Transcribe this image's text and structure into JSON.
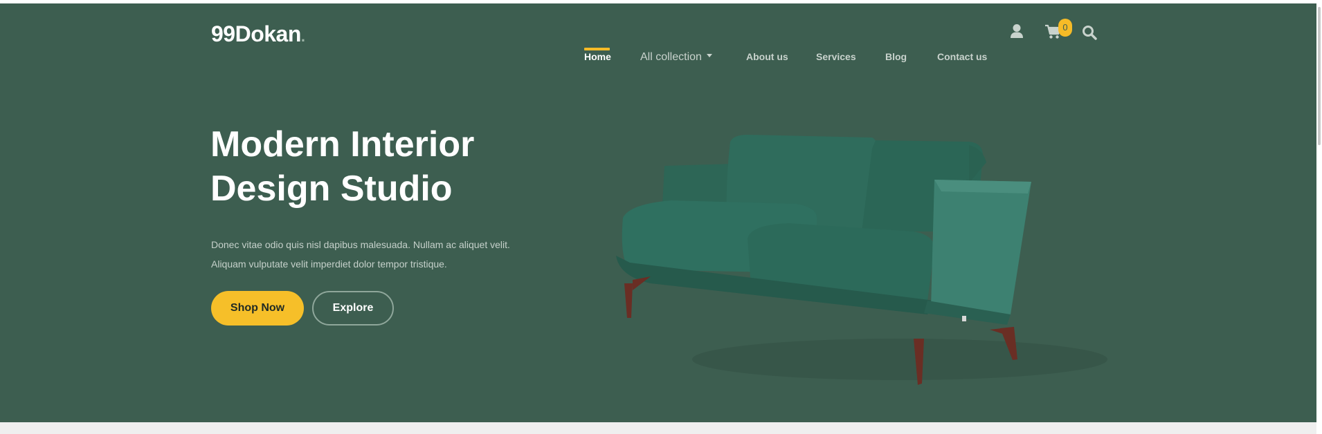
{
  "header": {
    "logo": "99Dokan",
    "logo_dot": ".",
    "nav": [
      {
        "label": "Home",
        "active": true
      },
      {
        "label": "All collection"
      },
      {
        "label": "About us"
      },
      {
        "label": "Services"
      },
      {
        "label": "Blog"
      },
      {
        "label": "Contact us"
      }
    ],
    "cart_count": "0",
    "icons": [
      "user-icon",
      "cart-icon",
      "search-icon"
    ]
  },
  "hero": {
    "headline_line1": "Modern Interior",
    "headline_line2": "Design Studio",
    "subtext_line1": "Donec vitae odio quis nisl dapibus malesuada. Nullam ac aliquet velit.",
    "subtext_line2": "Aliquam vulputate velit imperdiet dolor tempor tristique.",
    "primary_button": "Shop Now",
    "secondary_button": "Explore"
  },
  "colors": {
    "hero_bg": "#3d5e50",
    "accent": "#f6bb27",
    "sofa": "#2e6a5b"
  }
}
